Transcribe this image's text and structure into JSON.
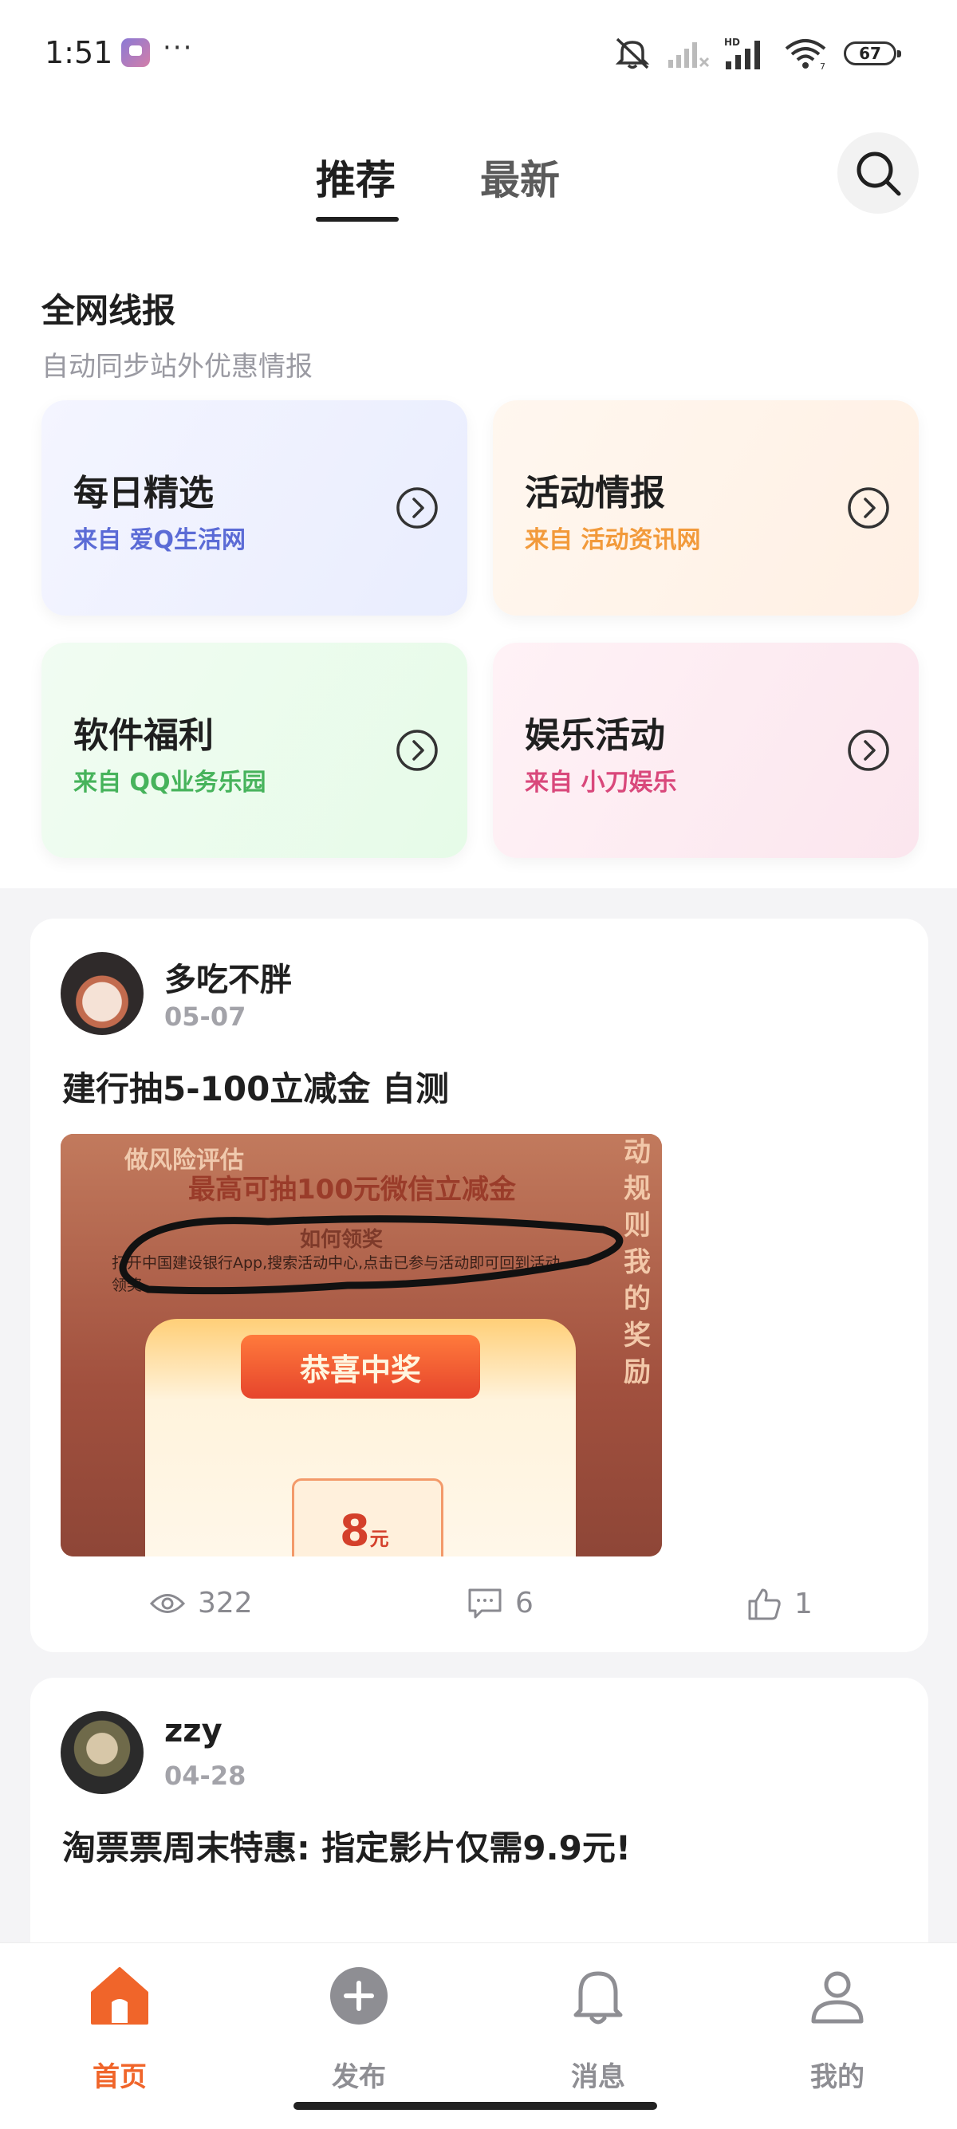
{
  "status_bar": {
    "time": "1:51",
    "more": "···",
    "battery": "67",
    "icons": [
      "notification-app-icon",
      "mute-icon",
      "signal-weak-icon",
      "hd-signal-icon",
      "wifi-icon",
      "battery-icon"
    ]
  },
  "header": {
    "tabs": [
      {
        "label": "推荐",
        "active": true
      },
      {
        "label": "最新",
        "active": false
      }
    ],
    "search_icon": "search-icon"
  },
  "section": {
    "title": "全网线报",
    "subtitle": "自动同步站外优惠情报",
    "cards": [
      {
        "title": "每日精选",
        "source": "来自 爱Q生活网"
      },
      {
        "title": "活动情报",
        "source": "来自 活动资讯网"
      },
      {
        "title": "软件福利",
        "source": "来自 QQ业务乐园"
      },
      {
        "title": "娱乐活动",
        "source": "来自 小刀娱乐"
      }
    ]
  },
  "posts": [
    {
      "author": "多吃不胖",
      "date": "05-07",
      "title": "建行抽5-100立减金  自测",
      "image": {
        "banner_top": "做风险评估",
        "banner_main": "最高可抽100元微信立减金",
        "how_title": "如何领奖",
        "how_text": "打开中国建设银行App,搜索活动中心,点击已参与活动即可回到活动领奖。",
        "side_text": "动规则 我的奖励",
        "ribbon": "恭喜中奖",
        "amount": "8",
        "amount_unit": "元"
      },
      "views": "322",
      "comments": "6",
      "likes": "1"
    },
    {
      "author": "zzy",
      "date": "04-28",
      "title": "淘票票周末特惠: 指定影片仅需9.9元!"
    }
  ],
  "bottom_nav": [
    {
      "label": "首页",
      "icon": "home-icon",
      "active": true
    },
    {
      "label": "发布",
      "icon": "add-circle-icon",
      "active": false
    },
    {
      "label": "消息",
      "icon": "bell-icon",
      "active": false
    },
    {
      "label": "我的",
      "icon": "user-icon",
      "active": false
    }
  ],
  "colors": {
    "accent": "#f0652a",
    "blue": "#5b6bd6",
    "orange": "#f29a3b",
    "green": "#46b35b",
    "pink": "#d9487b"
  }
}
